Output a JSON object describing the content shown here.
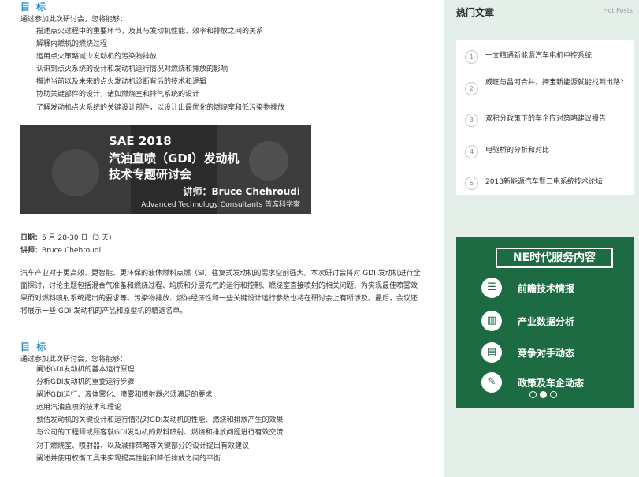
{
  "section1": {
    "title": "目 标",
    "intro": "通过参加此次研讨会，您将能够：",
    "items": [
      "描述点火过程中的重要环节，及其与发动机性能、效率和排放之间的关系",
      "解释内燃机的燃烧过程",
      "运用点火策略减少发动机的污染物排放",
      "认识到点火系统的设计和发动机运行情况对燃烧和排放的影响",
      "描述当前以及未来的点火发动机诊断背后的技术和逻辑",
      "协助关键部件的设计，诸如燃烧室和排气系统的设计",
      "了解发动机点火系统的关键设计部件，以设计出最优化的燃烧室和低污染物排放"
    ]
  },
  "banner": {
    "line1": "SAE 2018",
    "line2": "汽油直喷（GDI）发动机",
    "line3": "技术专题研讨会",
    "speaker": "讲师：Bruce Chehroudi",
    "org": "Advanced Technology Consultants 首席科学家"
  },
  "meta": {
    "date_label": "日期：",
    "date_value": "5 月 28-30 日（3 天）",
    "speaker_label": "讲师：",
    "speaker_value": "Bruce Chehroudi"
  },
  "paragraph": "汽车产业对于更高效、更智能、更环保的液体燃料点燃（SI）往复式发动机的需求空前强大。本次研讨会将对 GDI 发动机进行全面探讨，讨论主题包括混合气准备和燃烧过程、均质和分层充气的运行和控制、燃烧室直接喷射的相关问题、为实现最佳喷雾效果而对燃料喷射系统提出的要求等。污染物排放、燃油经济性和一些关键设计运行参数也将在研讨会上有所涉及。最后，会议还将展示一些 GDI 发动机的产品和原型机的精选名单。",
  "section2": {
    "title": "目 标",
    "intro": "通过参加此次研讨会，您将能够：",
    "items": [
      "阐述GDI发动机的基本运行原理",
      "分析GDI发动机的重要运行步骤",
      "阐述GDI运行、液体雾化、喷雾和喷射器必须满足的要求",
      "运用汽油直喷的技术和理论",
      "预估发动机的关键设计和运行情况对GDI发动机的性能、燃烧和排放产生的效果",
      "与公司的工程师或顾客就GDI发动机的燃料喷射、燃烧和排放问题进行有效交流",
      "对于燃烧室、喷射器、以及减排策略等关键部分的设计提出有效建议",
      "阐述并使用权衡工具来实现提高性能和降低排放之间的平衡"
    ]
  },
  "sidebar": {
    "title": "热门文章",
    "subtitle": "Hot Posts",
    "posts": [
      {
        "num": "1",
        "text": "一文精通新能源汽车电机电控系统"
      },
      {
        "num": "2",
        "text": "威旺与昌河合并，押宝新能源就能找到出路?"
      },
      {
        "num": "3",
        "text": "双积分政策下的车企应对策略建议报告"
      },
      {
        "num": "4",
        "text": "电驱桥的分析和对比"
      },
      {
        "num": "5",
        "text": "2018新能源汽车暨三电系统技术论坛"
      }
    ],
    "services": {
      "title": "NE时代服务内容",
      "items": [
        {
          "icon": "news-icon",
          "glyph": "☰",
          "label": "前瞻技术情报"
        },
        {
          "icon": "chart-icon",
          "glyph": "▥",
          "label": "产业数据分析"
        },
        {
          "icon": "competitor-icon",
          "glyph": "▤",
          "label": "竞争对手动态"
        },
        {
          "icon": "policy-icon",
          "glyph": "✎",
          "label": "政策及车企动态"
        }
      ]
    }
  }
}
